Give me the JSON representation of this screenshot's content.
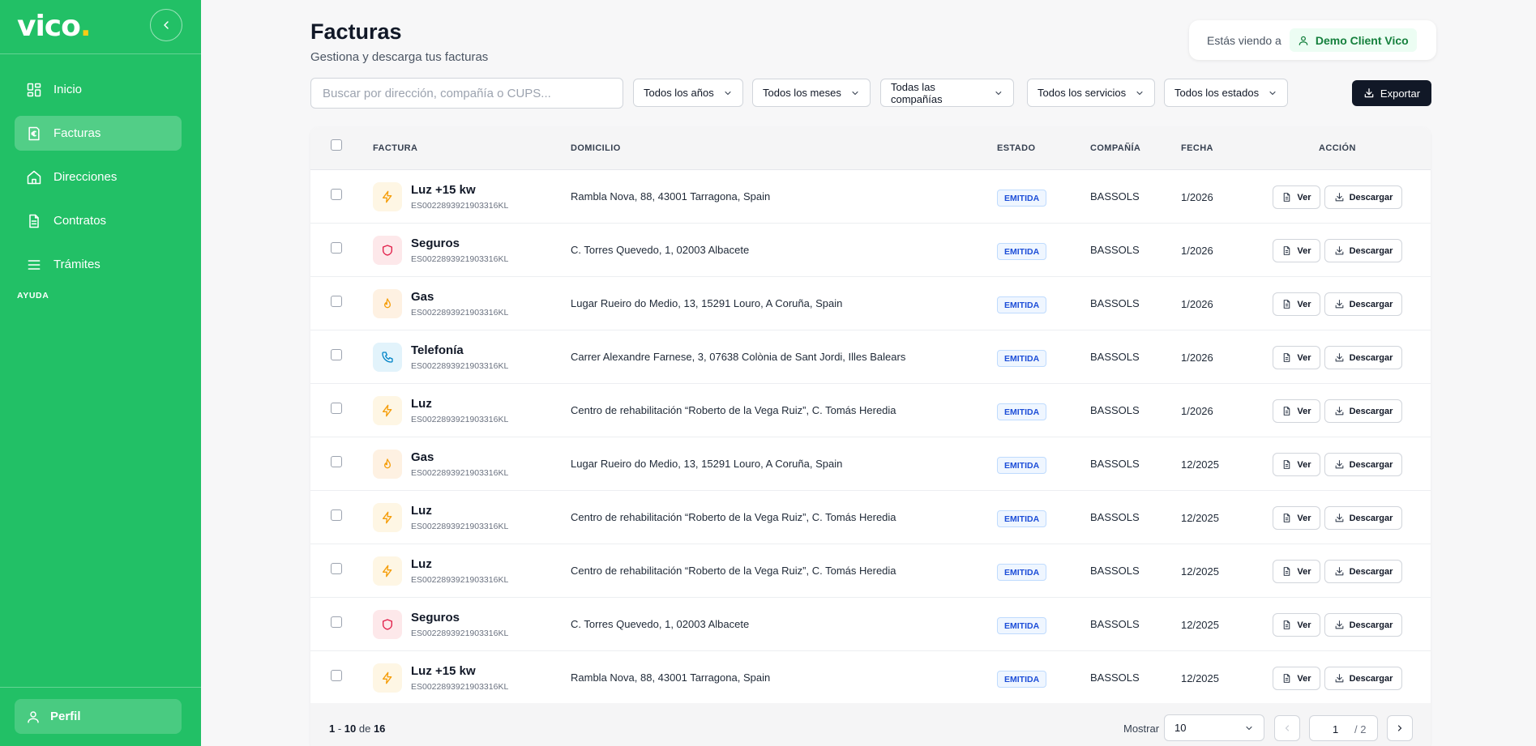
{
  "sidebar": {
    "logo": "vico",
    "logo_dot": ".",
    "items": [
      {
        "label": "Inicio",
        "icon": "grid-icon",
        "active": false
      },
      {
        "label": "Facturas",
        "icon": "invoice-euro-icon",
        "active": true
      },
      {
        "label": "Direcciones",
        "icon": "home-icon",
        "active": false
      },
      {
        "label": "Contratos",
        "icon": "document-icon",
        "active": false
      },
      {
        "label": "Trámites",
        "icon": "list-icon",
        "active": false
      }
    ],
    "help_label": "AYUDA",
    "profile_label": "Perfil"
  },
  "header": {
    "title": "Facturas",
    "subtitle": "Gestiona y descarga tus facturas",
    "viewing_text": "Estás viendo a",
    "client_name": "Demo Client Vico"
  },
  "filters": {
    "search_placeholder": "Buscar por dirección, compañía o CUPS...",
    "year": "Todos los años",
    "month": "Todos los meses",
    "company": "Todas las compañías",
    "service": "Todos los servicios",
    "status": "Todos los estados",
    "export_label": "Exportar"
  },
  "table": {
    "columns": {
      "invoice": "FACTURA",
      "address": "DOMICILIO",
      "status": "ESTADO",
      "company": "COMPAÑÍA",
      "date": "FECHA",
      "action": "ACCIÓN"
    },
    "view_label": "Ver",
    "download_label": "Descargar",
    "rows": [
      {
        "service": "Luz +15 kw",
        "type": "power",
        "code": "ES0022893921903316KL",
        "address": "Rambla Nova, 88, 43001 Tarragona, Spain",
        "status": "EMITIDA",
        "company": "BASSOLS",
        "date": "1/2026"
      },
      {
        "service": "Seguros",
        "type": "insurance",
        "code": "ES0022893921903316KL",
        "address": "C. Torres Quevedo, 1, 02003 Albacete",
        "status": "EMITIDA",
        "company": "BASSOLS",
        "date": "1/2026"
      },
      {
        "service": "Gas",
        "type": "gas",
        "code": "ES0022893921903316KL",
        "address": "Lugar Rueiro do Medio, 13, 15291 Louro, A Coruña, Spain",
        "status": "EMITIDA",
        "company": "BASSOLS",
        "date": "1/2026"
      },
      {
        "service": "Telefonía",
        "type": "phone",
        "code": "ES0022893921903316KL",
        "address": "Carrer Alexandre Farnese, 3, 07638 Colònia de Sant Jordi, Illes Balears",
        "status": "EMITIDA",
        "company": "BASSOLS",
        "date": "1/2026"
      },
      {
        "service": "Luz",
        "type": "power",
        "code": "ES0022893921903316KL",
        "address": "Centro de rehabilitación “Roberto de la Vega Ruiz”, C. Tomás Heredia",
        "status": "EMITIDA",
        "company": "BASSOLS",
        "date": "1/2026"
      },
      {
        "service": "Gas",
        "type": "gas",
        "code": "ES0022893921903316KL",
        "address": "Lugar Rueiro do Medio, 13, 15291 Louro, A Coruña, Spain",
        "status": "EMITIDA",
        "company": "BASSOLS",
        "date": "12/2025"
      },
      {
        "service": "Luz",
        "type": "power",
        "code": "ES0022893921903316KL",
        "address": "Centro de rehabilitación “Roberto de la Vega Ruiz”, C. Tomás Heredia",
        "status": "EMITIDA",
        "company": "BASSOLS",
        "date": "12/2025"
      },
      {
        "service": "Luz",
        "type": "power",
        "code": "ES0022893921903316KL",
        "address": "Centro de rehabilitación “Roberto de la Vega Ruiz”, C. Tomás Heredia",
        "status": "EMITIDA",
        "company": "BASSOLS",
        "date": "12/2025"
      },
      {
        "service": "Seguros",
        "type": "insurance",
        "code": "ES0022893921903316KL",
        "address": "C. Torres Quevedo, 1, 02003 Albacete",
        "status": "EMITIDA",
        "company": "BASSOLS",
        "date": "12/2025"
      },
      {
        "service": "Luz +15 kw",
        "type": "power",
        "code": "ES0022893921903316KL",
        "address": "Rambla Nova, 88, 43001 Tarragona, Spain",
        "status": "EMITIDA",
        "company": "BASSOLS",
        "date": "12/2025"
      }
    ]
  },
  "pagination": {
    "range_start": "1",
    "range_dash": " - ",
    "range_end": "10",
    "range_of": " de ",
    "total": "16",
    "show_label": "Mostrar",
    "page_size": "10",
    "current_page": "1",
    "total_pages": "/ 2"
  },
  "colors": {
    "brand_green": "#22c066",
    "power_bg": "#fef6e4",
    "power_fg": "#f59e0b",
    "insurance_bg": "#fde8ea",
    "insurance_fg": "#e11d48",
    "gas_bg": "#fef1e2",
    "gas_fg": "#f59e0b",
    "phone_bg": "#e2f3fb",
    "phone_fg": "#0284c7"
  }
}
